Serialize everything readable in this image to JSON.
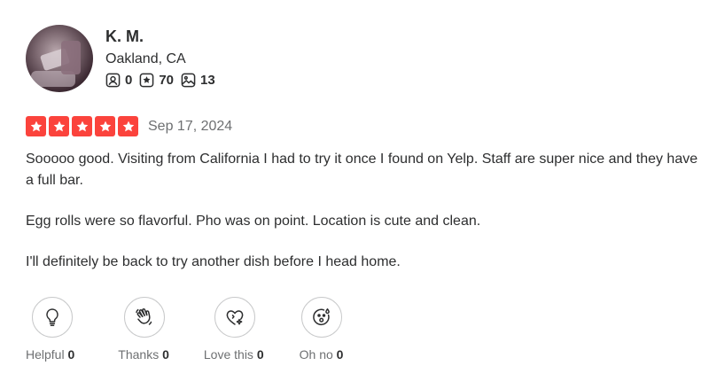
{
  "user": {
    "name": "K. M.",
    "location": "Oakland, CA",
    "stats": {
      "friends": "0",
      "reviews": "70",
      "photos": "13"
    },
    "icons": {
      "friends": "friends-icon",
      "reviews": "review-star-icon",
      "photos": "photo-icon"
    }
  },
  "review": {
    "rating": 5,
    "rating_max": 5,
    "star_color": "#fb433c",
    "date": "Sep 17, 2024",
    "paragraphs": [
      "Sooooo good. Visiting from California I had to try it once I found on Yelp. Staff are super nice and they have a full bar.",
      "Egg rolls were so flavorful. Pho was on point. Location is cute and clean.",
      "I'll definitely be back to try another dish before I head home."
    ]
  },
  "reactions": [
    {
      "label": "Helpful",
      "count": "0",
      "icon": "lightbulb-icon"
    },
    {
      "label": "Thanks",
      "count": "0",
      "icon": "waving-hand-icon"
    },
    {
      "label": "Love this",
      "count": "0",
      "icon": "heart-sparkle-icon"
    },
    {
      "label": "Oh no",
      "count": "0",
      "icon": "surprised-face-icon"
    }
  ]
}
